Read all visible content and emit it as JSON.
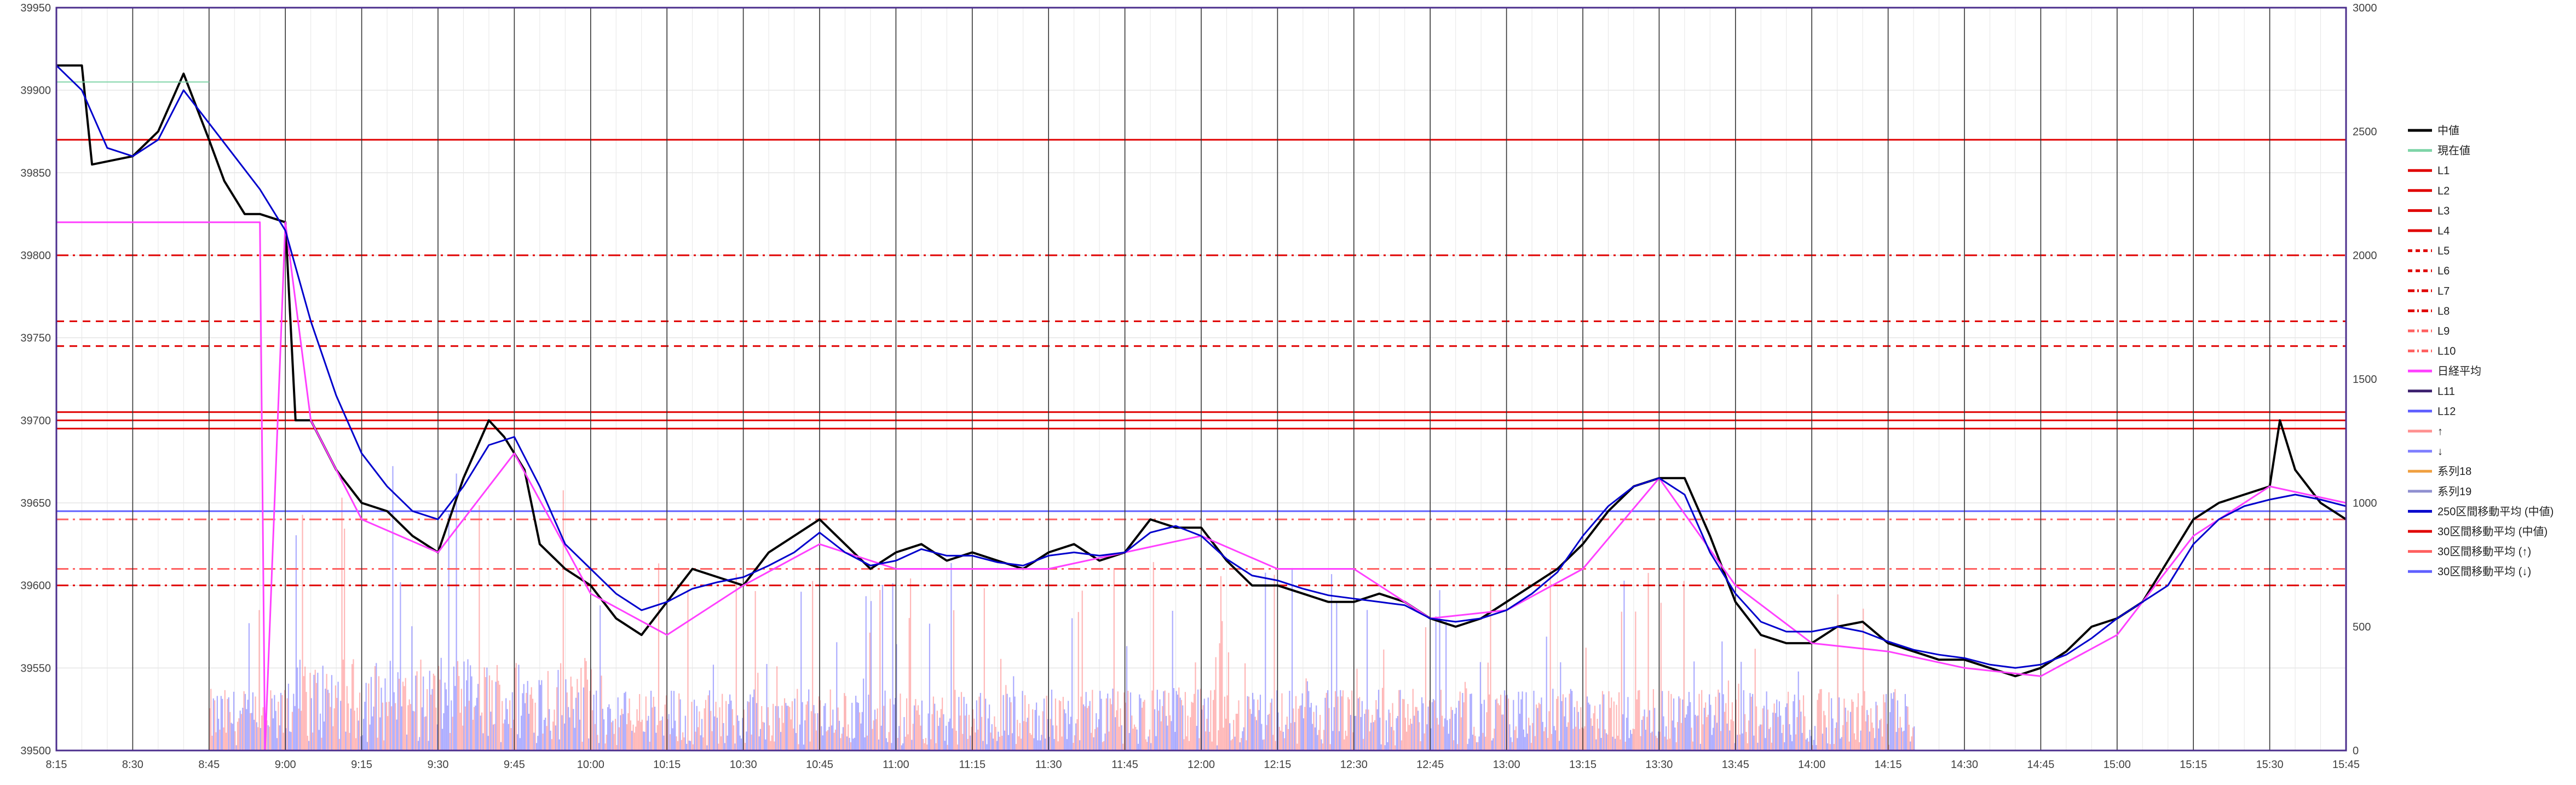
{
  "chart_data": {
    "type": "line",
    "title": "",
    "xlabel": "",
    "ylabel": "",
    "y_left": {
      "ylim": [
        39500,
        39950
      ],
      "ticks": [
        "39500",
        "39550",
        "39600",
        "39650",
        "39700",
        "39750",
        "39800",
        "39850",
        "39900",
        "39950"
      ]
    },
    "y_right": {
      "ylim": [
        0,
        3000
      ],
      "ticks": [
        "0",
        "500",
        "1000",
        "1500",
        "2000",
        "2500",
        "3000"
      ]
    },
    "x_ticks": [
      "8:15",
      "8:30",
      "8:45",
      "9:00",
      "9:15",
      "9:30",
      "9:45",
      "10:00",
      "10:15",
      "10:30",
      "10:45",
      "11:00",
      "11:15",
      "11:30",
      "11:45",
      "12:00",
      "12:15",
      "12:30",
      "12:45",
      "13:00",
      "13:15",
      "13:30",
      "13:45",
      "14:00",
      "14:15",
      "14:30",
      "14:45",
      "15:00",
      "15:15",
      "15:30",
      "15:45"
    ],
    "legend_position": "right",
    "grid": true,
    "vertical_markers": [
      "8:30",
      "8:45",
      "9:00",
      "9:15",
      "9:30",
      "9:45",
      "10:00",
      "10:15",
      "10:30",
      "10:45",
      "11:00",
      "11:15",
      "11:30",
      "11:45",
      "12:00",
      "12:15",
      "12:30",
      "12:45",
      "13:00",
      "13:15",
      "13:30",
      "13:45",
      "14:00",
      "14:15",
      "14:30",
      "14:45",
      "15:00",
      "15:15",
      "15:30"
    ],
    "horizontal_levels": [
      {
        "name": "L1",
        "value": 39870,
        "color": "#e00000",
        "style": "solid"
      },
      {
        "name": "L2",
        "value": 39705,
        "color": "#e00000",
        "style": "solid"
      },
      {
        "name": "L3",
        "value": 39700,
        "color": "#e00000",
        "style": "solid"
      },
      {
        "name": "L4",
        "value": 39695,
        "color": "#e00000",
        "style": "solid"
      },
      {
        "name": "L5",
        "value": 39760,
        "color": "#e00000",
        "style": "dashed"
      },
      {
        "name": "L6",
        "value": 39745,
        "color": "#e00000",
        "style": "dashed"
      },
      {
        "name": "L7",
        "value": 39800,
        "color": "#e00000",
        "style": "dashdot"
      },
      {
        "name": "L8",
        "value": 39600,
        "color": "#e00000",
        "style": "dashdot"
      },
      {
        "name": "L9",
        "value": 39610,
        "color": "#ff6060",
        "style": "dashdot"
      },
      {
        "name": "L10",
        "value": 39640,
        "color": "#ff6060",
        "style": "dashdot"
      },
      {
        "name": "L12",
        "value": 39645,
        "color": "#6060ff",
        "style": "solid"
      }
    ],
    "series": [
      {
        "name": "中値",
        "color": "#000000",
        "x": [
          "8:15",
          "8:20",
          "8:22",
          "8:30",
          "8:35",
          "8:40",
          "8:45",
          "8:48",
          "8:52",
          "8:55",
          "9:00",
          "9:02",
          "9:05",
          "9:10",
          "9:15",
          "9:20",
          "9:25",
          "9:30",
          "9:35",
          "9:40",
          "9:43",
          "9:47",
          "9:50",
          "9:55",
          "10:00",
          "10:05",
          "10:10",
          "10:15",
          "10:20",
          "10:25",
          "10:30",
          "10:35",
          "10:40",
          "10:45",
          "10:50",
          "10:55",
          "11:00",
          "11:05",
          "11:10",
          "11:15",
          "11:20",
          "11:25",
          "11:30",
          "11:35",
          "11:40",
          "11:45",
          "11:50",
          "11:55",
          "12:00",
          "12:05",
          "12:10",
          "12:15",
          "12:20",
          "12:25",
          "12:30",
          "12:35",
          "12:40",
          "12:45",
          "12:50",
          "12:55",
          "13:00",
          "13:05",
          "13:10",
          "13:15",
          "13:20",
          "13:25",
          "13:30",
          "13:35",
          "13:40",
          "13:45",
          "13:50",
          "13:55",
          "14:00",
          "14:05",
          "14:10",
          "14:15",
          "14:20",
          "14:25",
          "14:30",
          "14:35",
          "14:40",
          "14:45",
          "14:50",
          "14:55",
          "15:00",
          "15:05",
          "15:10",
          "15:15",
          "15:20",
          "15:25",
          "15:30",
          "15:32",
          "15:35",
          "15:40",
          "15:45"
        ],
        "values": [
          39915,
          39915,
          39855,
          39860,
          39875,
          39910,
          39870,
          39845,
          39825,
          39825,
          39820,
          39700,
          39700,
          39670,
          39650,
          39645,
          39630,
          39620,
          39665,
          39700,
          39690,
          39670,
          39625,
          39610,
          39600,
          39580,
          39570,
          39590,
          39610,
          39605,
          39600,
          39620,
          39630,
          39640,
          39625,
          39610,
          39620,
          39625,
          39615,
          39620,
          39615,
          39610,
          39620,
          39625,
          39615,
          39620,
          39640,
          39635,
          39635,
          39615,
          39600,
          39600,
          39595,
          39590,
          39590,
          39595,
          39590,
          39580,
          39575,
          39580,
          39590,
          39600,
          39610,
          39625,
          39645,
          39660,
          39665,
          39665,
          39630,
          39590,
          39570,
          39565,
          39565,
          39575,
          39578,
          39565,
          39560,
          39555,
          39555,
          39550,
          39545,
          39550,
          39560,
          39575,
          39580,
          39590,
          39615,
          39640,
          39650,
          39655,
          39660,
          39700,
          39670,
          39650,
          39640
        ]
      },
      {
        "name": "現在値",
        "color": "#7fd4a8",
        "x": [
          "8:15",
          "8:45"
        ],
        "values": [
          39905,
          39905
        ]
      },
      {
        "name": "日経平均",
        "color": "#ff40ff",
        "x": [
          "8:15",
          "8:55",
          "8:56",
          "9:00",
          "9:05",
          "9:15",
          "9:30",
          "9:45",
          "10:00",
          "10:15",
          "10:30",
          "10:45",
          "11:00",
          "11:15",
          "11:30",
          "11:45",
          "12:00",
          "12:15",
          "12:30",
          "12:45",
          "13:00",
          "13:15",
          "13:30",
          "13:45",
          "14:00",
          "14:15",
          "14:30",
          "14:45",
          "15:00",
          "15:15",
          "15:30",
          "15:45"
        ],
        "values": [
          39820,
          39820,
          39500,
          39820,
          39700,
          39640,
          39620,
          39680,
          39595,
          39570,
          39600,
          39625,
          39610,
          39610,
          39610,
          39620,
          39630,
          39610,
          39610,
          39580,
          39585,
          39610,
          39665,
          39600,
          39565,
          39560,
          39550,
          39545,
          39570,
          39630,
          39660,
          39650
        ]
      },
      {
        "name": "250区間移動平均 (中値)",
        "color": "#0000cc",
        "x": [
          "8:15",
          "8:20",
          "8:25",
          "8:30",
          "8:35",
          "8:40",
          "8:45",
          "8:50",
          "8:55",
          "9:00",
          "9:05",
          "9:10",
          "9:15",
          "9:20",
          "9:25",
          "9:30",
          "9:35",
          "9:40",
          "9:45",
          "9:50",
          "9:55",
          "10:00",
          "10:05",
          "10:10",
          "10:15",
          "10:20",
          "10:25",
          "10:30",
          "10:35",
          "10:40",
          "10:45",
          "10:50",
          "10:55",
          "11:00",
          "11:05",
          "11:10",
          "11:15",
          "11:20",
          "11:25",
          "11:30",
          "11:35",
          "11:40",
          "11:45",
          "11:50",
          "11:55",
          "12:00",
          "12:05",
          "12:10",
          "12:15",
          "12:20",
          "12:25",
          "12:30",
          "12:35",
          "12:40",
          "12:45",
          "12:50",
          "12:55",
          "13:00",
          "13:05",
          "13:10",
          "13:15",
          "13:20",
          "13:25",
          "13:30",
          "13:35",
          "13:40",
          "13:45",
          "13:50",
          "13:55",
          "14:00",
          "14:05",
          "14:10",
          "14:15",
          "14:20",
          "14:25",
          "14:30",
          "14:35",
          "14:40",
          "14:45",
          "14:50",
          "14:55",
          "15:00",
          "15:05",
          "15:10",
          "15:15",
          "15:20",
          "15:25",
          "15:30",
          "15:35",
          "15:40",
          "15:45"
        ],
        "values": [
          39915,
          39900,
          39865,
          39860,
          39870,
          39900,
          39880,
          39860,
          39840,
          39815,
          39760,
          39715,
          39680,
          39660,
          39645,
          39640,
          39660,
          39685,
          39690,
          39660,
          39625,
          39610,
          39595,
          39585,
          39590,
          39598,
          39602,
          39605,
          39612,
          39620,
          39632,
          39620,
          39612,
          39615,
          39622,
          39618,
          39618,
          39614,
          39612,
          39618,
          39620,
          39618,
          39620,
          39632,
          39636,
          39630,
          39616,
          39606,
          39603,
          39598,
          39594,
          39592,
          39590,
          39588,
          39580,
          39578,
          39580,
          39585,
          39595,
          39608,
          39630,
          39648,
          39660,
          39665,
          39655,
          39620,
          39595,
          39578,
          39572,
          39572,
          39575,
          39572,
          39566,
          39561,
          39558,
          39556,
          39552,
          39550,
          39552,
          39558,
          39568,
          39580,
          39590,
          39600,
          39625,
          39640,
          39648,
          39652,
          39655,
          39652,
          39648
        ]
      }
    ],
    "volume": {
      "axis": "right",
      "up_color": "#ff9090",
      "down_color": "#8080ff",
      "start": "8:45",
      "end": "14:20",
      "typical_range": [
        20,
        250
      ],
      "max_peak": 920
    },
    "legend": [
      "中値",
      "現在値",
      "L1",
      "L2",
      "L3",
      "L4",
      "L5",
      "L6",
      "L7",
      "L8",
      "L9",
      "L10",
      "日経平均",
      "L11",
      "L12",
      "↑",
      "↓",
      "系列18",
      "系列19",
      "250区間移動平均 (中値)",
      "30区間移動平均 (中値)",
      "30区間移動平均 (↑)",
      "30区間移動平均 (↓)"
    ],
    "legend_colors": [
      "#000000",
      "#7fd4a8",
      "#e00000",
      "#e00000",
      "#e00000",
      "#e00000",
      "#e00000",
      "#e00000",
      "#e00000",
      "#e00000",
      "#ff6060",
      "#ff6060",
      "#ff40ff",
      "#3c1f6e",
      "#6060ff",
      "#ff9090",
      "#8080ff",
      "#f0a040",
      "#9090d0",
      "#0000cc",
      "#e00000",
      "#ff6060",
      "#6060ff"
    ],
    "legend_styles": [
      "solid",
      "solid",
      "solid",
      "solid",
      "solid",
      "solid",
      "dashed",
      "dashed",
      "dashdot",
      "dashdot",
      "dashdot",
      "dashdot",
      "solid",
      "solid",
      "solid",
      "solid",
      "solid",
      "solid",
      "solid",
      "solid",
      "solid",
      "solid",
      "solid"
    ]
  }
}
